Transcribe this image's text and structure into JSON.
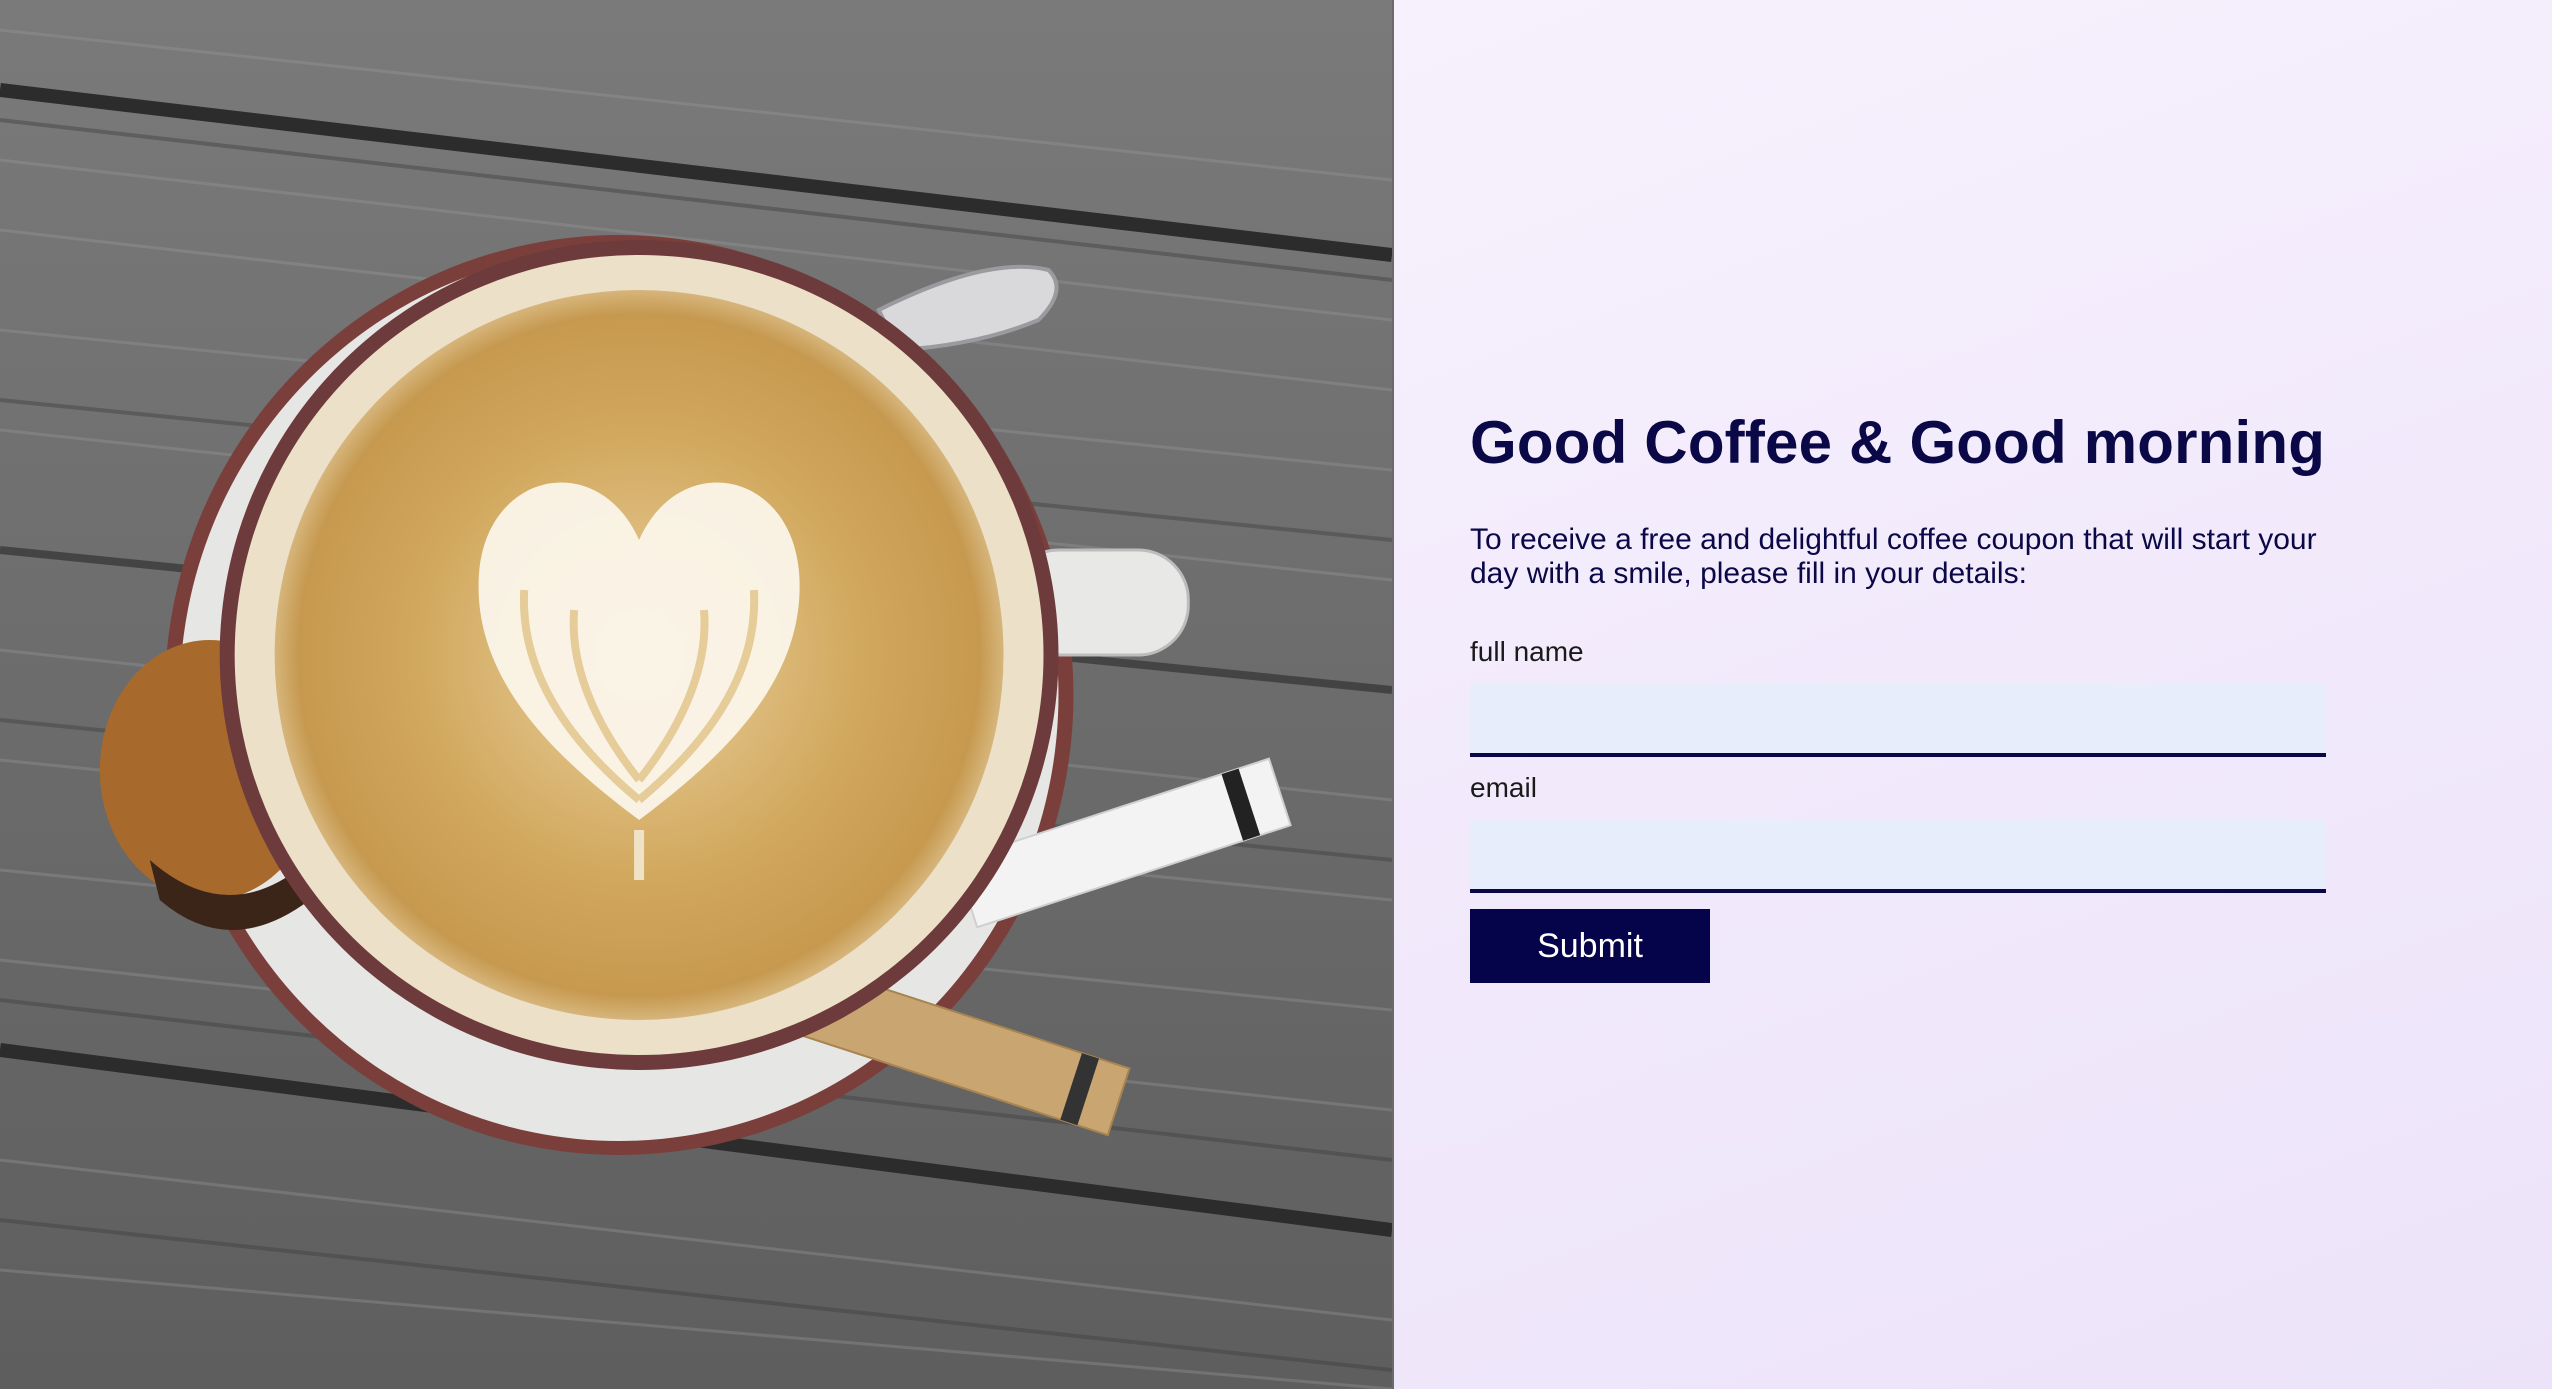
{
  "hero": {
    "image_alt": "Latte with heart art on a weathered wooden table"
  },
  "form": {
    "title": "Good Coffee & Good morning",
    "intro": "To receive a free and delightful coffee coupon that will start your day with a smile, please fill in your details:",
    "name_label": "full name",
    "name_value": "",
    "email_label": "email",
    "email_value": "",
    "submit_label": "Submit"
  },
  "colors": {
    "heading": "#0a0847",
    "button": "#05034a",
    "input_bg": "#e8edfb",
    "panel_bg": "#f4edfc"
  }
}
